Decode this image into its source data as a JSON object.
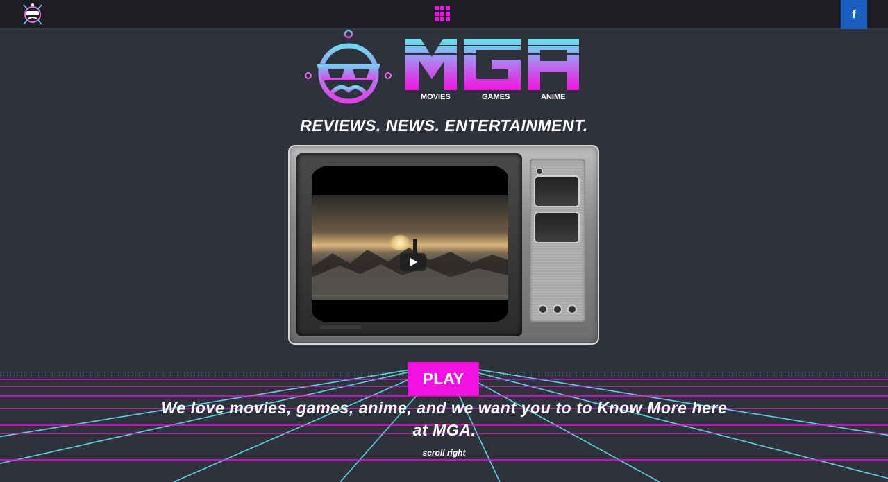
{
  "header": {
    "logo_icon": "mga-robot-logo",
    "menu_icon": "grid-menu-icon",
    "facebook_label": "f",
    "brand_color": "#f012e0",
    "facebook_color": "#1a5fc2"
  },
  "hero": {
    "brand": "MGA",
    "sub_movies": "MOVIES",
    "sub_games": "GAMES",
    "sub_anime": "ANIME",
    "tagline": "REVIEWS. NEWS. ENTERTAINMENT."
  },
  "tv": {
    "video_icon": "play-icon"
  },
  "cta": {
    "play_label": "PLAY",
    "message": "We love movies, games, anime, and we want you to to Know More here at MGA.",
    "scroll_hint": "scroll right"
  },
  "colors": {
    "background": "#2f323c",
    "topbar": "#1d1e24",
    "grid_pink": "#f012e0",
    "grid_cyan": "#5fe6ee"
  }
}
